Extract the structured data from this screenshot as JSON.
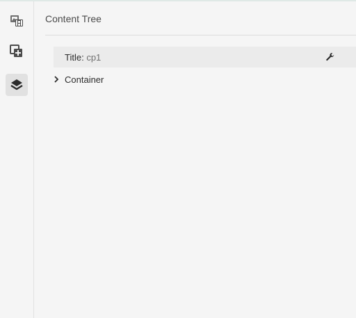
{
  "rail": {
    "items": [
      {
        "icon": "assets-icon",
        "label": "Assets",
        "active": false
      },
      {
        "icon": "components-icon",
        "label": "Components",
        "active": false
      },
      {
        "icon": "content-tree-icon",
        "label": "Content Tree",
        "active": true
      }
    ]
  },
  "panel": {
    "title": "Content Tree",
    "tree": {
      "root": {
        "key": "Title:",
        "value": "cp1",
        "action_icon": "wrench-icon"
      },
      "children": [
        {
          "label": "Container",
          "expand_icon": "chevron-right-icon",
          "expanded": false
        }
      ]
    }
  },
  "colors": {
    "background": "#f5f5f5",
    "selected_row": "#ebebeb",
    "active_rail": "#e1e1e1",
    "text": "#2c2c2c"
  }
}
